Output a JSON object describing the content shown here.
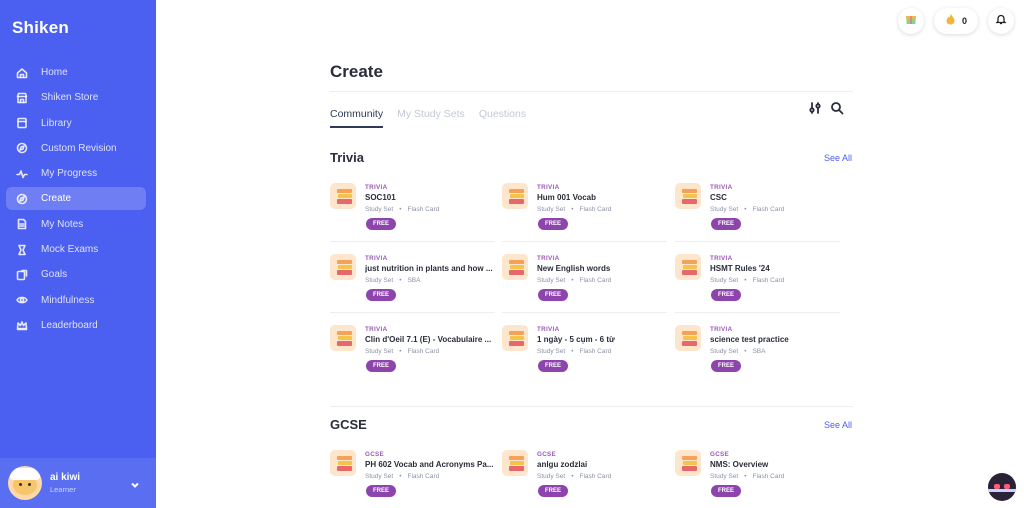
{
  "app": {
    "logo": "Shiken"
  },
  "sidebar": {
    "items": [
      {
        "label": "Home",
        "icon": "home-icon"
      },
      {
        "label": "Shiken Store",
        "icon": "store-icon"
      },
      {
        "label": "Library",
        "icon": "library-icon"
      },
      {
        "label": "Custom Revision",
        "icon": "compass-icon"
      },
      {
        "label": "My Progress",
        "icon": "progress-icon"
      },
      {
        "label": "Create",
        "icon": "create-icon",
        "active": true
      },
      {
        "label": "My Notes",
        "icon": "notes-icon"
      },
      {
        "label": "Mock Exams",
        "icon": "exam-icon"
      },
      {
        "label": "Goals",
        "icon": "goals-icon"
      },
      {
        "label": "Mindfulness",
        "icon": "eye-icon"
      },
      {
        "label": "Leaderboard",
        "icon": "crown-icon"
      }
    ],
    "user": {
      "name": "ai kiwi",
      "role": "Learner"
    }
  },
  "topbar": {
    "streak_count": "0"
  },
  "main": {
    "title": "Create",
    "tabs": [
      {
        "label": "Community",
        "active": true
      },
      {
        "label": "My Study Sets"
      },
      {
        "label": "Questions"
      }
    ],
    "sections": [
      {
        "title": "Trivia",
        "see_all": "See All",
        "cards": [
          {
            "category": "TRIVIA",
            "title": "SOC101",
            "type": "Study Set",
            "kind": "Flash Card",
            "badge": "FREE"
          },
          {
            "category": "TRIVIA",
            "title": "Hum 001 Vocab",
            "type": "Study Set",
            "kind": "Flash Card",
            "badge": "FREE"
          },
          {
            "category": "TRIVIA",
            "title": "CSC",
            "type": "Study Set",
            "kind": "Flash Card",
            "badge": "FREE"
          },
          {
            "category": "TRIVIA",
            "title": "just nutrition in plants and how ...",
            "type": "Study Set",
            "kind": "SBA",
            "badge": "FREE"
          },
          {
            "category": "TRIVIA",
            "title": "New English words",
            "type": "Study Set",
            "kind": "Flash Card",
            "badge": "FREE"
          },
          {
            "category": "TRIVIA",
            "title": "HSMT Rules '24",
            "type": "Study Set",
            "kind": "Flash Card",
            "badge": "FREE"
          },
          {
            "category": "TRIVIA",
            "title": "Clin d'Oeil 7.1 (E) - Vocabulaire ...",
            "type": "Study Set",
            "kind": "Flash Card",
            "badge": "FREE"
          },
          {
            "category": "TRIVIA",
            "title": "1 ngày - 5 cụm - 6 từ",
            "type": "Study Set",
            "kind": "Flash Card",
            "badge": "FREE"
          },
          {
            "category": "TRIVIA",
            "title": "science test practice",
            "type": "Study Set",
            "kind": "SBA",
            "badge": "FREE"
          }
        ]
      },
      {
        "title": "GCSE",
        "see_all": "See All",
        "cards": [
          {
            "category": "GCSE",
            "title": "PH 602 Vocab and Acronyms Pa...",
            "type": "Study Set",
            "kind": "Flash Card",
            "badge": "FREE"
          },
          {
            "category": "GCSE",
            "title": "anlgu zodzlai",
            "type": "Study Set",
            "kind": "Flash Card",
            "badge": "FREE"
          },
          {
            "category": "GCSE",
            "title": "NMS: Overview",
            "type": "Study Set",
            "kind": "Flash Card",
            "badge": "FREE"
          }
        ]
      }
    ]
  }
}
